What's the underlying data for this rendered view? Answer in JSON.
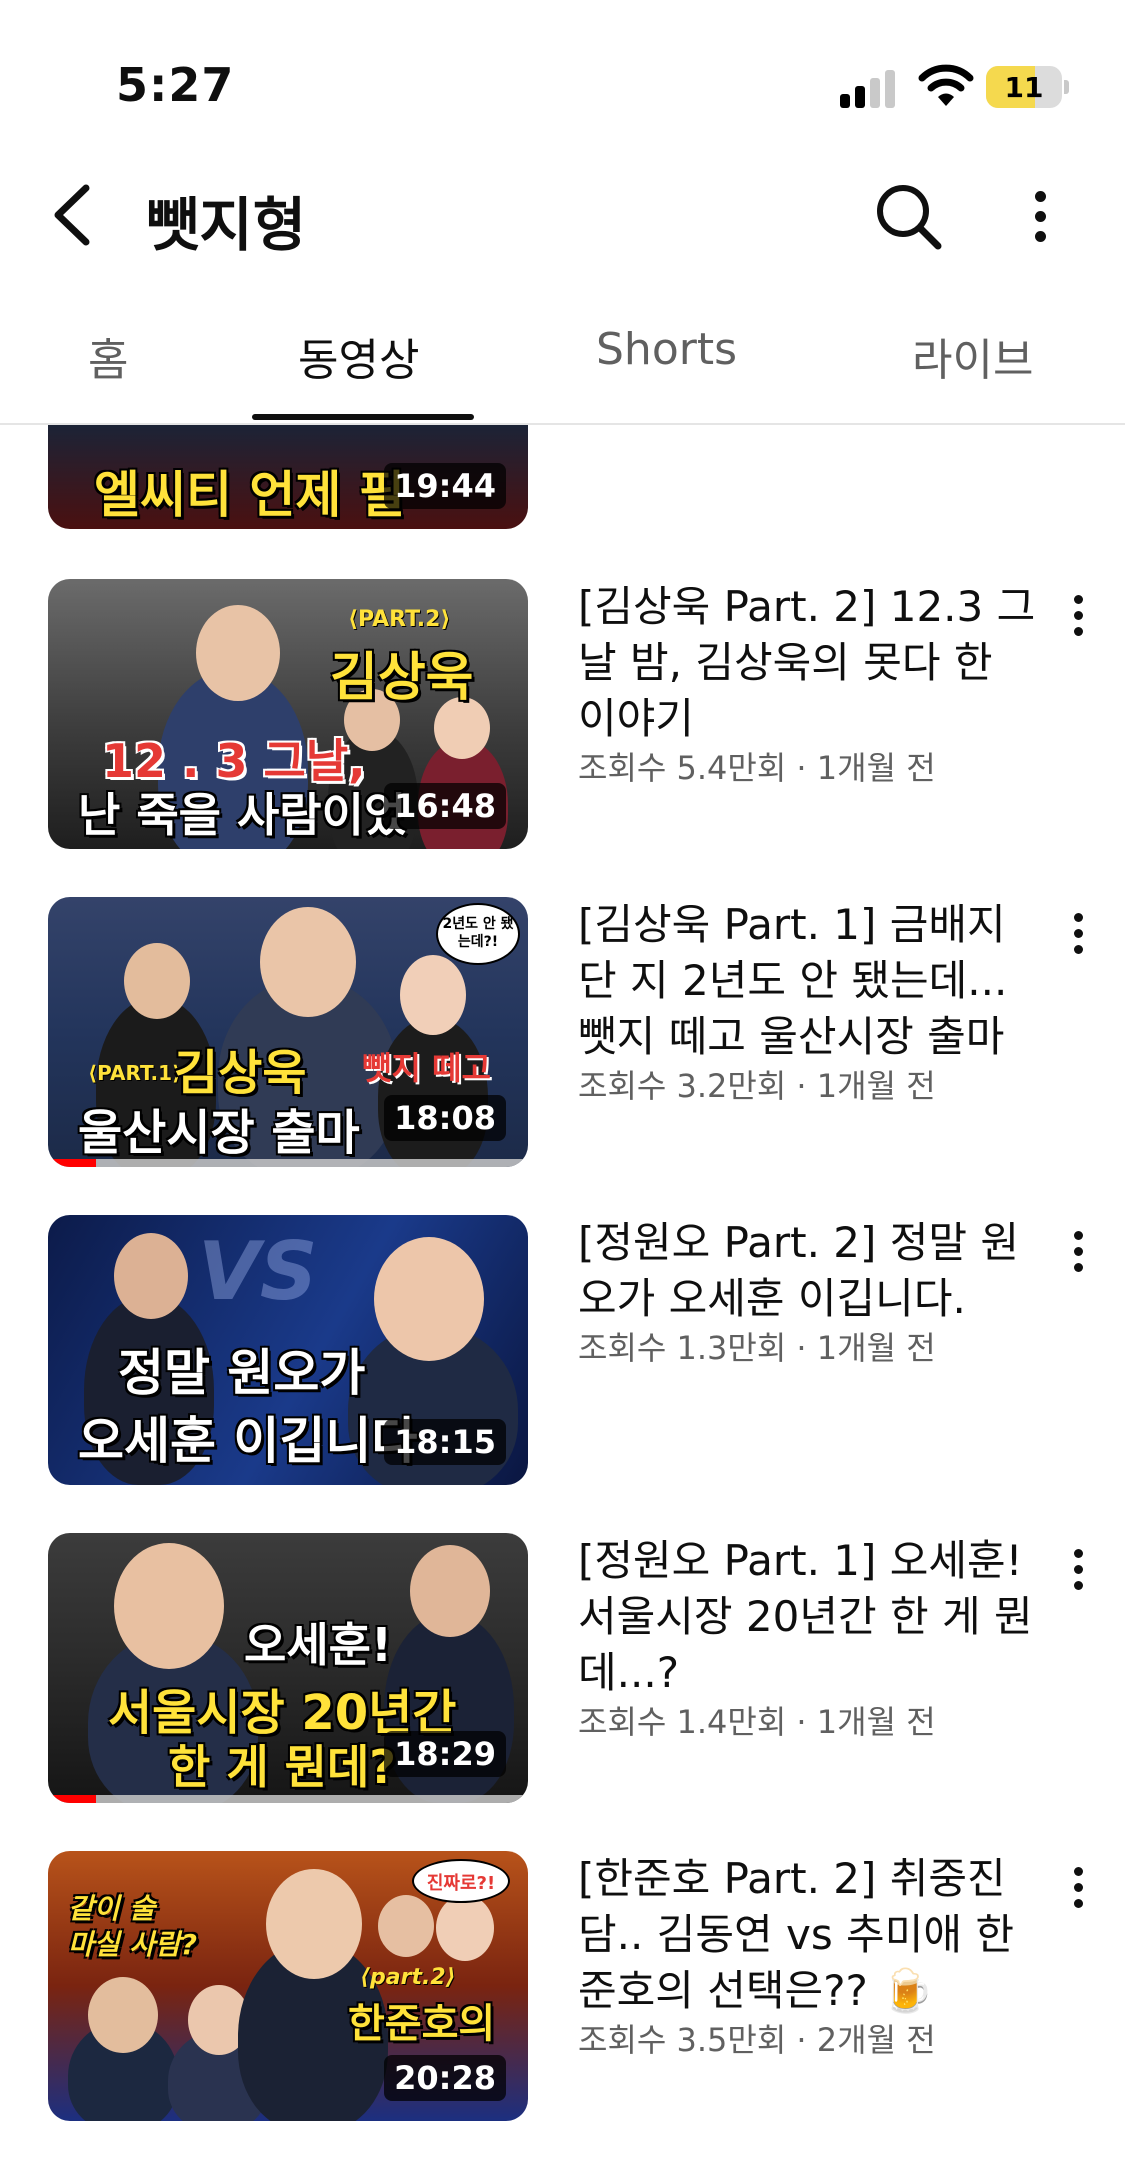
{
  "status_bar": {
    "time": "5:27",
    "battery_level": "11",
    "battery_fraction": 0.11
  },
  "header": {
    "channel_name": "뺏지형",
    "back_icon": "chevron-left-icon",
    "search_icon": "search-icon",
    "more_icon": "more-vert-icon"
  },
  "tabs": [
    {
      "label": "홈",
      "active": false
    },
    {
      "label": "동영상",
      "active": true
    },
    {
      "label": "Shorts",
      "active": false
    },
    {
      "label": "라이브",
      "active": false
    }
  ],
  "partial_video": {
    "thumb_caption": "엘씨티 언제 필",
    "duration": "19:44"
  },
  "videos": [
    {
      "title": "[김상욱 Part. 2] 12.3 그날 밤, 김상욱의 못다 한 이야기",
      "meta": "조회수 5.4만회 · 1개월 전",
      "duration": "16:48",
      "thumb_tag": "⟨PART.2⟩",
      "thumb_name": "김상욱",
      "thumb_line1": "12 . 3 그날,",
      "thumb_line2": "난 죽을 사람이었",
      "watched_fraction": 0
    },
    {
      "title": "[김상욱 Part. 1] 금배지 단 지 2년도 안 됐는데... 뺏지 떼고 울산시장 출마",
      "meta": "조회수 3.2만회 · 1개월 전",
      "duration": "18:08",
      "thumb_bubble": "2년도 안 됐는데?!",
      "thumb_tag": "⟨PART.1⟩",
      "thumb_name": "김상욱",
      "thumb_extra": "뺏지 떼고",
      "thumb_line2": "울산시장 출마",
      "watched_fraction": 0.1
    },
    {
      "title": "[정원오 Part. 2] 정말 원오가 오세훈 이깁니다.",
      "meta": "조회수 1.3만회 · 1개월 전",
      "duration": "18:15",
      "thumb_vs": "VS",
      "thumb_line1": "정말 원오가",
      "thumb_line2": "오세훈 이깁니다",
      "watched_fraction": 0
    },
    {
      "title": "[정원오 Part. 1] 오세훈! 서울시장 20년간 한 게 뭔데...?",
      "meta": "조회수 1.4만회 · 1개월 전",
      "duration": "18:29",
      "thumb_line0": "오세훈!",
      "thumb_line1": "서울시장 20년간",
      "thumb_line2": "한 게 뭔데?",
      "watched_fraction": 0.1
    },
    {
      "title": "[한준호 Part. 2] 취중진담.. 김동연 vs 추미애 한준호의 선택은?? 🍺",
      "meta": "조회수 3.5만회 · 2개월 전",
      "duration": "20:28",
      "thumb_line0": "같이 술",
      "thumb_line1": "마실 사람?",
      "thumb_bubble": "진짜로?!",
      "thumb_tag": "⟨part.2⟩",
      "thumb_name": "한준호의",
      "watched_fraction": 0
    }
  ]
}
